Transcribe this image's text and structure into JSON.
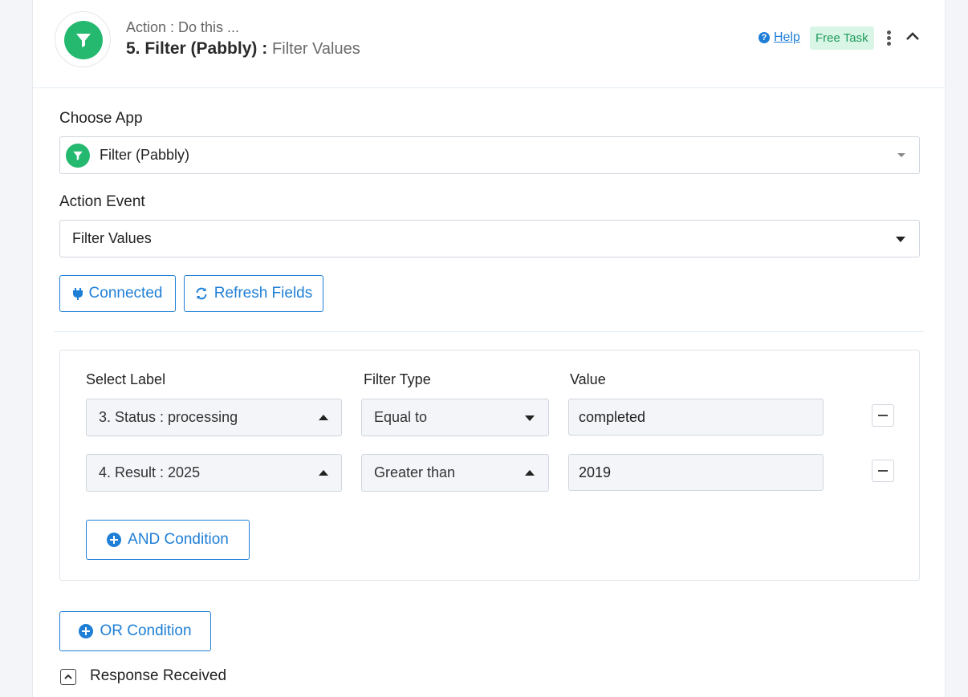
{
  "header": {
    "subtitle": "Action : Do this ...",
    "step_title": "5. Filter (Pabbly) :",
    "event_name": "Filter Values",
    "help_label": "Help",
    "badge": "Free Task",
    "icon": "filter-funnel-icon",
    "brand_color": "#25b86f"
  },
  "choose_app": {
    "label": "Choose App",
    "value": "Filter (Pabbly)"
  },
  "action_event": {
    "label": "Action Event",
    "value": "Filter Values"
  },
  "buttons": {
    "connected": "Connected",
    "refresh": "Refresh Fields"
  },
  "filter": {
    "columns": {
      "select_label": "Select Label",
      "filter_type": "Filter Type",
      "value": "Value"
    },
    "rows": [
      {
        "label": "3. Status : processing",
        "type": "Equal to",
        "value": "completed"
      },
      {
        "label": "4. Result : 2025",
        "type": "Greater than",
        "value": "2019"
      }
    ],
    "and_condition": "AND Condition"
  },
  "or_condition": "OR Condition",
  "response": {
    "label": "Response Received"
  },
  "colors": {
    "accent": "#1f7fd6",
    "badge_bg": "#d9f5e6",
    "badge_text": "#1f9a5c"
  }
}
